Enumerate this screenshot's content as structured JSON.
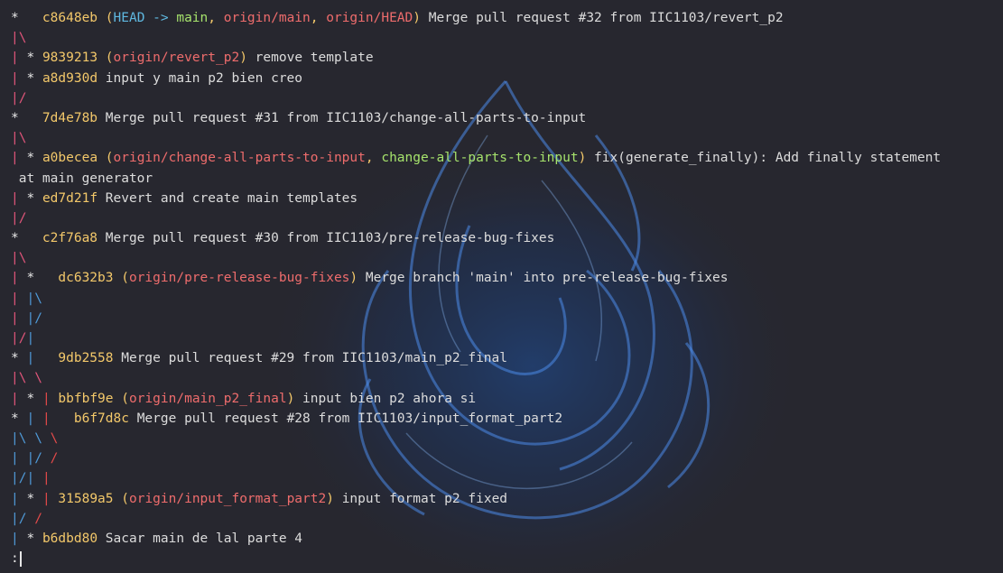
{
  "terminal": {
    "colors": {
      "background": "#27272f",
      "hash": "#f3c86a",
      "head": "#5fb8e0",
      "branch_local": "#a6e36c",
      "branch_remote": "#ee6c6c",
      "graph_1": "#e0557a",
      "graph_2": "#4f9ad8",
      "graph_3": "#e24a4a"
    },
    "background_art": "blue-flame",
    "prompt": ":",
    "lines": [
      [
        {
          "t": "*   ",
          "c": "star"
        },
        {
          "t": "c8648eb",
          "c": "hash"
        },
        {
          "t": " (",
          "c": "hash"
        },
        {
          "t": "HEAD -> ",
          "c": "head"
        },
        {
          "t": "main",
          "c": "main"
        },
        {
          "t": ", ",
          "c": "hash"
        },
        {
          "t": "origin/main",
          "c": "origin"
        },
        {
          "t": ", ",
          "c": "hash"
        },
        {
          "t": "origin/HEAD",
          "c": "origin"
        },
        {
          "t": ")",
          "c": "hash"
        },
        {
          "t": " Merge pull request #32 from IIC1103/revert_p2",
          "c": "msg"
        }
      ],
      [
        {
          "t": "|\\",
          "c": "g1"
        }
      ],
      [
        {
          "t": "| ",
          "c": "g1"
        },
        {
          "t": "* ",
          "c": "star"
        },
        {
          "t": "9839213",
          "c": "hash"
        },
        {
          "t": " (",
          "c": "hash"
        },
        {
          "t": "origin/revert_p2",
          "c": "origin"
        },
        {
          "t": ")",
          "c": "hash"
        },
        {
          "t": " remove template",
          "c": "msg"
        }
      ],
      [
        {
          "t": "| ",
          "c": "g1"
        },
        {
          "t": "* ",
          "c": "star"
        },
        {
          "t": "a8d930d",
          "c": "hash"
        },
        {
          "t": " input y main p2 bien creo",
          "c": "msg"
        }
      ],
      [
        {
          "t": "|/",
          "c": "g1"
        }
      ],
      [
        {
          "t": "*   ",
          "c": "star"
        },
        {
          "t": "7d4e78b",
          "c": "hash"
        },
        {
          "t": " Merge pull request #31 from IIC1103/change-all-parts-to-input",
          "c": "msg"
        }
      ],
      [
        {
          "t": "|\\",
          "c": "g1"
        }
      ],
      [
        {
          "t": "| ",
          "c": "g1"
        },
        {
          "t": "* ",
          "c": "star"
        },
        {
          "t": "a0becea",
          "c": "hash"
        },
        {
          "t": " (",
          "c": "hash"
        },
        {
          "t": "origin/change-all-parts-to-input",
          "c": "origin"
        },
        {
          "t": ", ",
          "c": "hash"
        },
        {
          "t": "change-all-parts-to-input",
          "c": "main"
        },
        {
          "t": ")",
          "c": "hash"
        },
        {
          "t": " fix(generate_finally): Add finally statement",
          "c": "msg"
        }
      ],
      [
        {
          "t": " at main generator",
          "c": "msg"
        }
      ],
      [
        {
          "t": "| ",
          "c": "g1"
        },
        {
          "t": "* ",
          "c": "star"
        },
        {
          "t": "ed7d21f",
          "c": "hash"
        },
        {
          "t": " Revert and create main templates",
          "c": "msg"
        }
      ],
      [
        {
          "t": "|/",
          "c": "g1"
        }
      ],
      [
        {
          "t": "*   ",
          "c": "star"
        },
        {
          "t": "c2f76a8",
          "c": "hash"
        },
        {
          "t": " Merge pull request #30 from IIC1103/pre-release-bug-fixes",
          "c": "msg"
        }
      ],
      [
        {
          "t": "|\\",
          "c": "g1"
        }
      ],
      [
        {
          "t": "| ",
          "c": "g1"
        },
        {
          "t": "*   ",
          "c": "star"
        },
        {
          "t": "dc632b3",
          "c": "hash"
        },
        {
          "t": " (",
          "c": "hash"
        },
        {
          "t": "origin/pre-release-bug-fixes",
          "c": "origin"
        },
        {
          "t": ")",
          "c": "hash"
        },
        {
          "t": " Merge branch 'main' into pre-release-bug-fixes",
          "c": "msg"
        }
      ],
      [
        {
          "t": "| ",
          "c": "g1"
        },
        {
          "t": "|\\",
          "c": "g2"
        }
      ],
      [
        {
          "t": "| ",
          "c": "g1"
        },
        {
          "t": "|/",
          "c": "g2"
        }
      ],
      [
        {
          "t": "|/",
          "c": "g1"
        },
        {
          "t": "|",
          "c": "g2"
        }
      ],
      [
        {
          "t": "* ",
          "c": "star"
        },
        {
          "t": "|   ",
          "c": "g2"
        },
        {
          "t": "9db2558",
          "c": "hash"
        },
        {
          "t": " Merge pull request #29 from IIC1103/main_p2_final",
          "c": "msg"
        }
      ],
      [
        {
          "t": "|\\ \\",
          "c": "g1"
        }
      ],
      [
        {
          "t": "| ",
          "c": "g1"
        },
        {
          "t": "* ",
          "c": "star"
        },
        {
          "t": "| ",
          "c": "g3"
        },
        {
          "t": "bbfbf9e",
          "c": "hash"
        },
        {
          "t": " (",
          "c": "hash"
        },
        {
          "t": "origin/main_p2_final",
          "c": "origin"
        },
        {
          "t": ")",
          "c": "hash"
        },
        {
          "t": " input bien p2 ahora si",
          "c": "msg"
        }
      ],
      [
        {
          "t": "* ",
          "c": "star"
        },
        {
          "t": "| ",
          "c": "g2"
        },
        {
          "t": "|   ",
          "c": "g3"
        },
        {
          "t": "b6f7d8c",
          "c": "hash"
        },
        {
          "t": " Merge pull request #28 from IIC1103/input_format_part2",
          "c": "msg"
        }
      ],
      [
        {
          "t": "|\\ ",
          "c": "g2"
        },
        {
          "t": "\\ ",
          "c": "g2"
        },
        {
          "t": "\\",
          "c": "g3"
        }
      ],
      [
        {
          "t": "| ",
          "c": "g2"
        },
        {
          "t": "|/ ",
          "c": "g2"
        },
        {
          "t": "/",
          "c": "g3"
        }
      ],
      [
        {
          "t": "|/",
          "c": "g2"
        },
        {
          "t": "| ",
          "c": "g2"
        },
        {
          "t": "|",
          "c": "g3"
        }
      ],
      [
        {
          "t": "| ",
          "c": "g2"
        },
        {
          "t": "* ",
          "c": "star"
        },
        {
          "t": "| ",
          "c": "g3"
        },
        {
          "t": "31589a5",
          "c": "hash"
        },
        {
          "t": " (",
          "c": "hash"
        },
        {
          "t": "origin/input_format_part2",
          "c": "origin"
        },
        {
          "t": ")",
          "c": "hash"
        },
        {
          "t": " input format p2 fixed",
          "c": "msg"
        }
      ],
      [
        {
          "t": "|/ ",
          "c": "g2"
        },
        {
          "t": "/",
          "c": "g3"
        }
      ],
      [
        {
          "t": "| ",
          "c": "g2"
        },
        {
          "t": "* ",
          "c": "star"
        },
        {
          "t": "b6dbd80",
          "c": "hash"
        },
        {
          "t": " Sacar main de lal parte 4",
          "c": "msg"
        }
      ]
    ]
  }
}
